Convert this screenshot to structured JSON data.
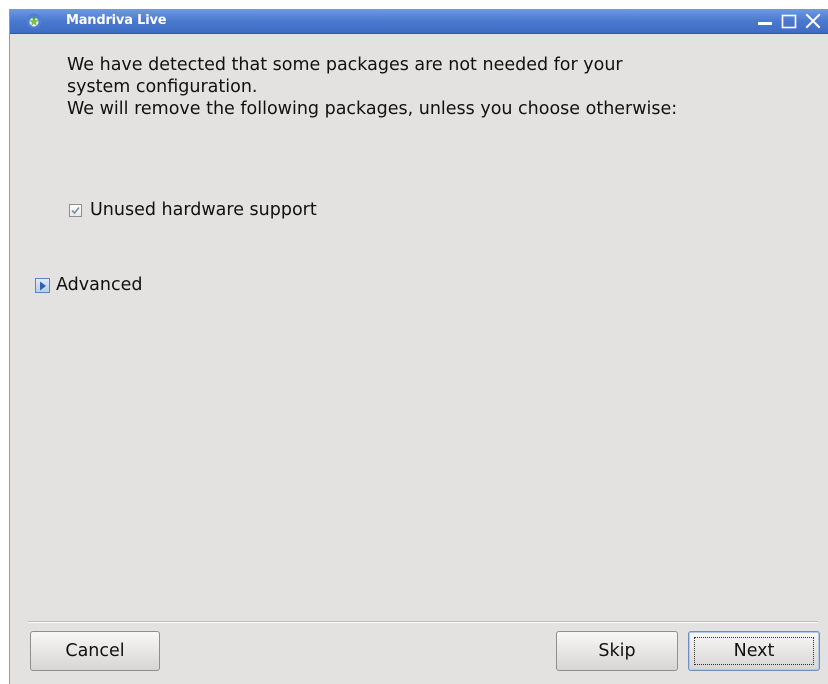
{
  "window": {
    "title": "Mandriva Live",
    "logo_icon": "mandriva-star-icon",
    "controls": {
      "minimize_icon": "minimize-icon",
      "maximize_icon": "maximize-icon",
      "close_icon": "close-icon"
    },
    "titlebar_color": "#4a79cf"
  },
  "message": {
    "line1": "We have detected that some packages are not needed for your",
    "line2": "system configuration.",
    "line3": "We will remove the following packages, unless you choose otherwise:"
  },
  "options": {
    "unused_hardware": {
      "label": "Unused hardware support",
      "checked": true
    }
  },
  "advanced": {
    "label": "Advanced",
    "expanded": false,
    "icon": "expander-arrow-right-icon"
  },
  "buttons": {
    "cancel": "Cancel",
    "skip": "Skip",
    "next": "Next"
  }
}
